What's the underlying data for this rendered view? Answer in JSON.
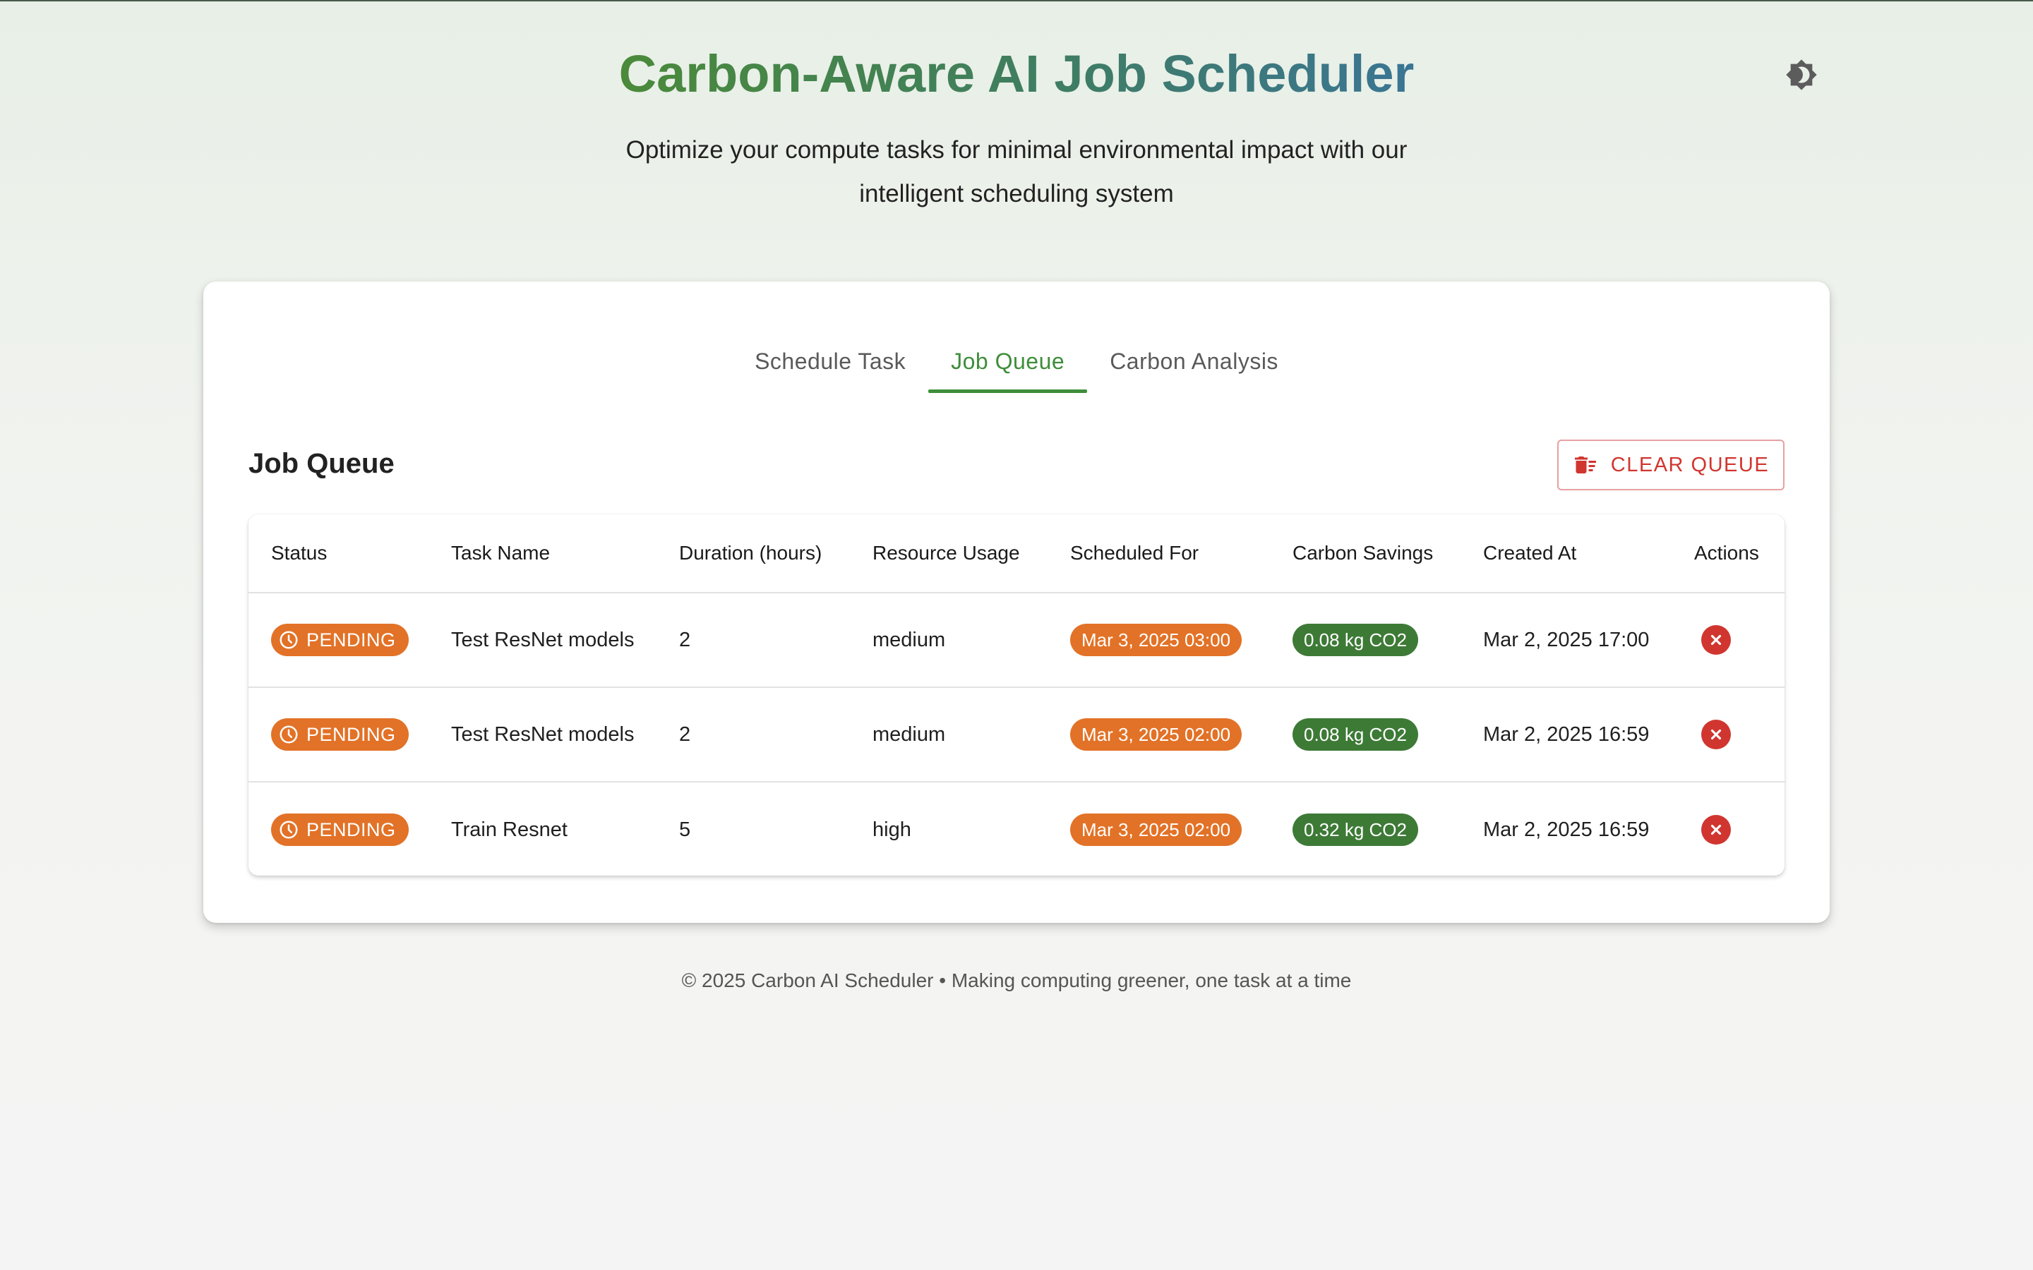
{
  "app": {
    "title": "Carbon-Aware AI Job Scheduler",
    "subtitle": "Optimize your compute tasks for minimal environmental impact with our intelligent scheduling system"
  },
  "tabs": [
    {
      "label": "Schedule Task",
      "active": false
    },
    {
      "label": "Job Queue",
      "active": true
    },
    {
      "label": "Carbon Analysis",
      "active": false
    }
  ],
  "queue": {
    "title": "Job Queue",
    "clear_label": "CLEAR QUEUE",
    "columns": [
      "Status",
      "Task Name",
      "Duration (hours)",
      "Resource Usage",
      "Scheduled For",
      "Carbon Savings",
      "Created At",
      "Actions"
    ],
    "rows": [
      {
        "status": "PENDING",
        "task": "Test ResNet models",
        "duration": "2",
        "resource": "medium",
        "scheduled": "Mar 3, 2025 03:00",
        "savings": "0.08 kg CO2",
        "created": "Mar 2, 2025 17:00"
      },
      {
        "status": "PENDING",
        "task": "Test ResNet models",
        "duration": "2",
        "resource": "medium",
        "scheduled": "Mar 3, 2025 02:00",
        "savings": "0.08 kg CO2",
        "created": "Mar 2, 2025 16:59"
      },
      {
        "status": "PENDING",
        "task": "Train Resnet",
        "duration": "5",
        "resource": "high",
        "scheduled": "Mar 3, 2025 02:00",
        "savings": "0.32 kg CO2",
        "created": "Mar 2, 2025 16:59"
      }
    ]
  },
  "footer": "© 2025 Carbon AI Scheduler • Making computing greener, one task at a time",
  "colors": {
    "primary_green": "#3e8e3a",
    "pending_orange": "#e27227",
    "savings_green": "#3d7a36",
    "danger_red": "#d0362f"
  },
  "icons": {
    "theme_toggle": "brightness-icon",
    "clear": "delete-sweep-icon",
    "status": "clock-icon",
    "cancel": "cancel-circle-icon"
  }
}
